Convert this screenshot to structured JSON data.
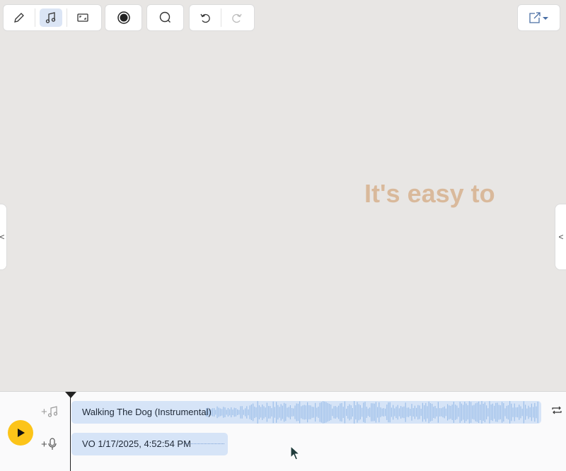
{
  "toolbar": {
    "groups": [
      {
        "name": "edit-tools",
        "items": [
          "pen-icon",
          "music-note-icon",
          "aspect-ratio-icon"
        ],
        "active": "music-note-icon"
      },
      {
        "name": "record",
        "items": [
          "record-icon"
        ]
      },
      {
        "name": "search",
        "items": [
          "search-icon"
        ]
      },
      {
        "name": "history",
        "items": [
          "undo-icon",
          "redo-icon"
        ]
      }
    ],
    "export_icon": "export-icon"
  },
  "canvas": {
    "text": "It's easy to",
    "text_color": "#d9b99b",
    "background": "#e8e6e4"
  },
  "side_handles": {
    "left_label": "<",
    "right_label": "<"
  },
  "timeline": {
    "play_color": "#fcc419",
    "add_music_label": "+",
    "add_voice_label": "+",
    "tracks": [
      {
        "label": "Walking The Dog (Instrumental)",
        "type": "music"
      },
      {
        "label": "VO 1/17/2025, 4:52:54 PM",
        "type": "voiceover"
      }
    ],
    "loop_icon": "loop-icon"
  },
  "colors": {
    "accent": "#dbe5f5",
    "track_fill": "#d6e4f7",
    "waveform": "#9dbfe9"
  }
}
